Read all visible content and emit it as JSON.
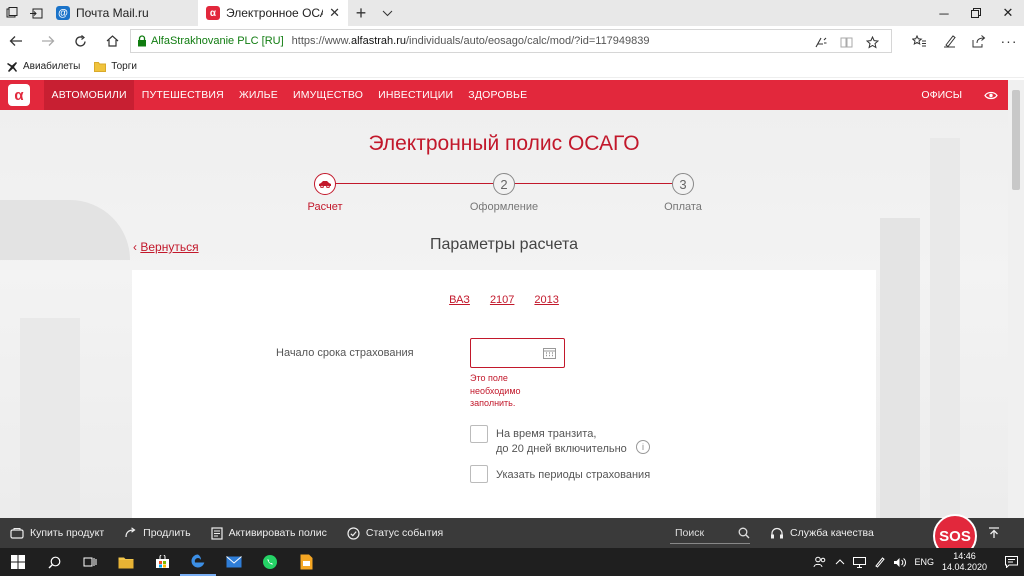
{
  "browser": {
    "tabs": [
      {
        "title": "Почта Mail.ru",
        "favicon": "@",
        "favicon_color": "#1a73c9"
      },
      {
        "title": "Электронное ОСАГО",
        "favicon": "α",
        "favicon_color": "#e2283c"
      }
    ],
    "new_tab": "+",
    "address": {
      "cert": "AlfaStrakhovanie PLC [RU]",
      "url_prefix": "https://www.",
      "url_domain": "alfastrah.ru",
      "url_path": "/individuals/auto/eosago/calc/mod/?id=117949839"
    },
    "favorites": [
      {
        "label": "Авиабилеты",
        "icon": "plane-icon"
      },
      {
        "label": "Торги",
        "icon": "folder-icon"
      }
    ]
  },
  "site": {
    "accent": "#e2283c",
    "logo": "α",
    "nav": [
      "АВТОМОБИЛИ",
      "ПУТЕШЕСТВИЯ",
      "ЖИЛЬЕ",
      "ИМУЩЕСТВО",
      "ИНВЕСТИЦИИ",
      "ЗДОРОВЬЕ"
    ],
    "nav_right": "ОФИСЫ"
  },
  "page": {
    "title": "Электронный полис ОСАГО",
    "steps": [
      {
        "label": "Расчет",
        "num": ""
      },
      {
        "label": "Оформление",
        "num": "2"
      },
      {
        "label": "Оплата",
        "num": "3"
      }
    ],
    "back": "Вернуться",
    "back_arrow": "‹",
    "section_title": "Параметры расчета",
    "car": {
      "make": "ВАЗ",
      "model": "2107",
      "year": "2013"
    },
    "start_label": "Начало срока страхования",
    "error": "Это поле необходимо заполнить.",
    "transit_line1": "На время транзита,",
    "transit_line2": "до 20 дней включительно",
    "periods": "Указать периоды страхования",
    "info": "i"
  },
  "bottom": {
    "buy": "Купить продукт",
    "extend": "Продлить",
    "activate": "Активировать полис",
    "status": "Статус события",
    "search_placeholder": "Поиск",
    "quality": "Служба качества",
    "sos": "SOS"
  },
  "taskbar": {
    "lang": "ENG",
    "time": "14:46",
    "date": "14.04.2020"
  }
}
